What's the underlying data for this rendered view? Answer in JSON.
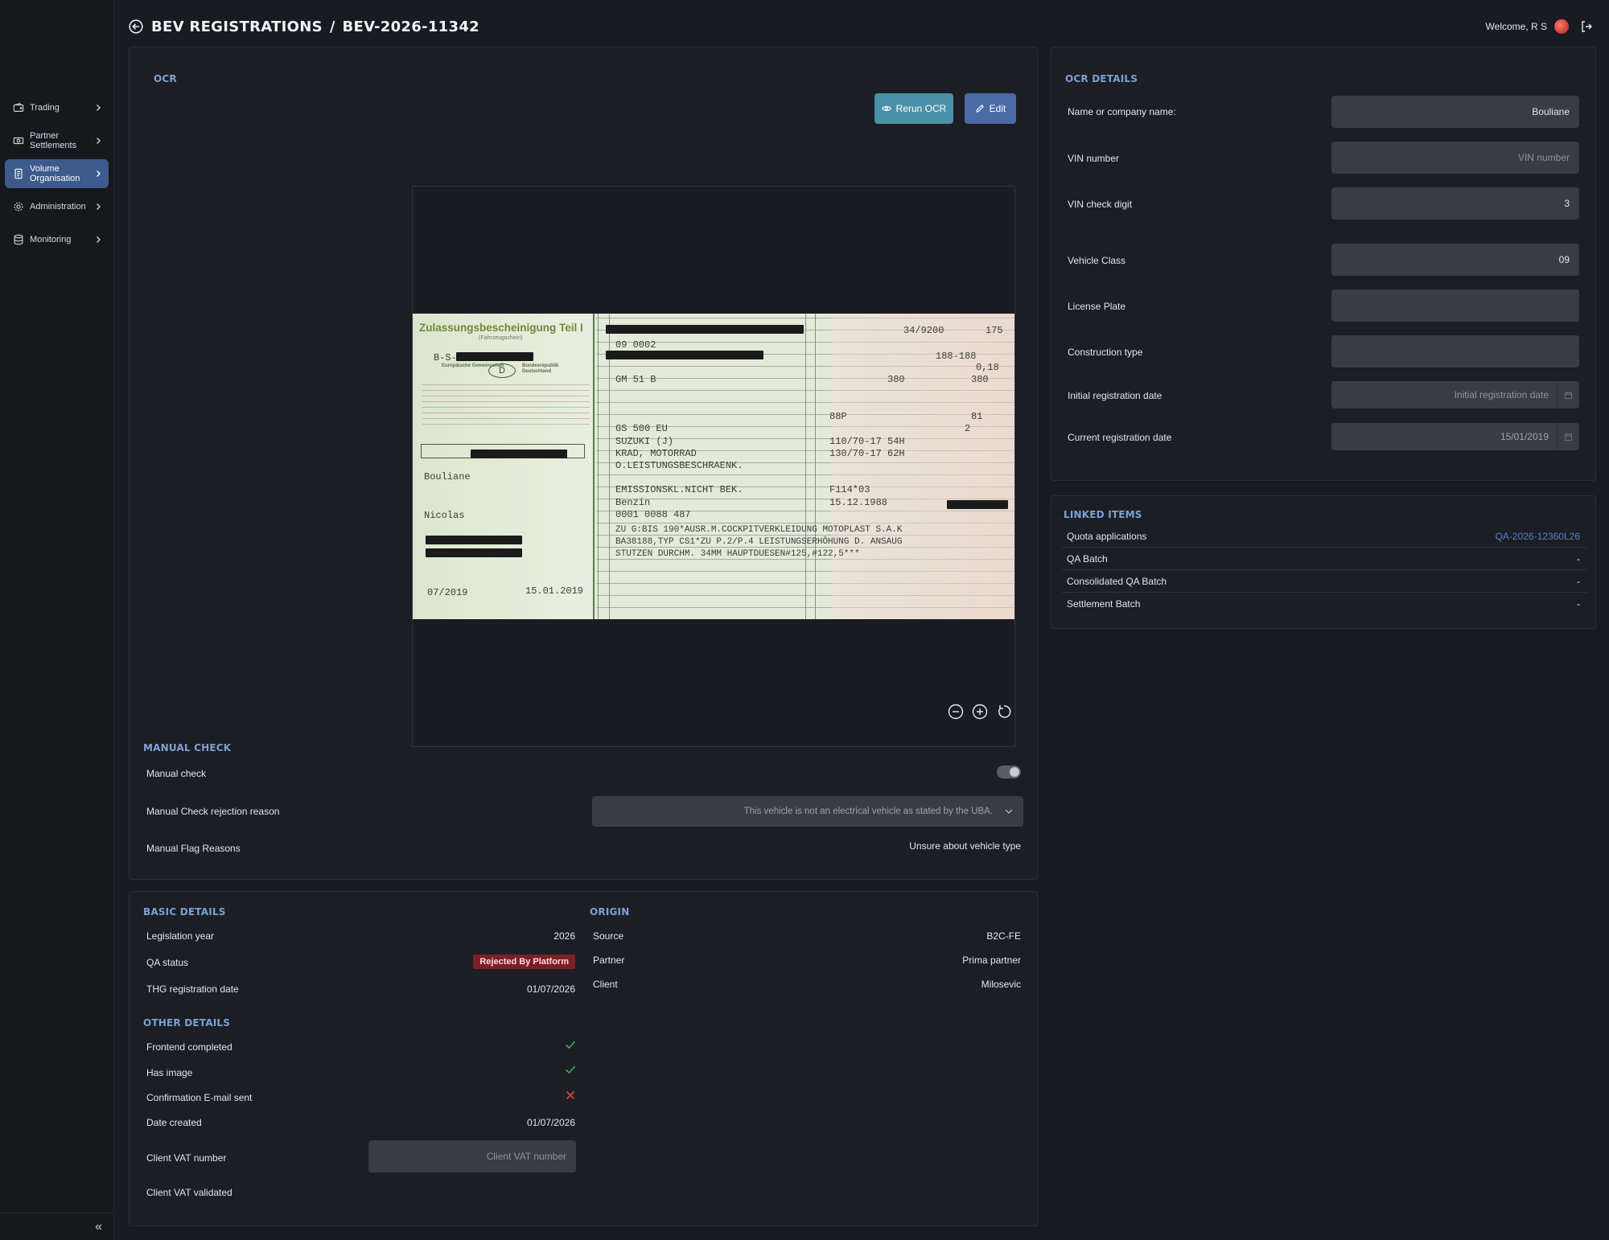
{
  "header": {
    "crumb_section": "BEV REGISTRATIONS",
    "crumb_sep": "/",
    "crumb_record": "BEV-2026-11342",
    "welcome": "Welcome, R S"
  },
  "sidebar": {
    "items": [
      {
        "label": "Trading",
        "icon": "wallet-icon"
      },
      {
        "label": "Partner Settlements",
        "icon": "money-icon"
      },
      {
        "label": "Volume Organisation",
        "icon": "document-icon",
        "active": true
      },
      {
        "label": "Administration",
        "icon": "gear-icon"
      },
      {
        "label": "Monitoring",
        "icon": "database-icon"
      }
    ],
    "collapse": "«"
  },
  "ocr": {
    "title": "OCR",
    "rerun_label": "Rerun OCR",
    "edit_label": "Edit",
    "doc": {
      "title": "Zulassungsbescheinigung Teil I",
      "subtitle": "(Fahrzeugschein)",
      "country": "D",
      "left_top": "Europäische Gemeinschaft",
      "left_right": "Bundesrepublik Deutschland",
      "prefix": "B-S-",
      "name": "Bouliane",
      "firstname": "Nicolas",
      "date_left": "07/2019",
      "date_right": "15.01.2019",
      "lines": [
        "09            0002",
        "GM 51 B",
        "GS 500 EU",
        "SUZUKI (J)",
        "KRAD, MOTORRAD",
        "O.LEISTUNGSBESCHRAENK.",
        "EMISSIONSKL.NICHT BEK.",
        "Benzin",
        "0001      0088      487",
        "ZU G:BIS 190*AUSR.M.COCKPITVERKLEIDUNG MOTOPLAST S.A.K",
        "BA38188,TYP CS1*ZU P.2/P.4 LEISTUNGSERHÖHUNG D. ANSAUG",
        "STUTZEN DURCHM. 34MM HAUPTDUESEN#125,#122,5***"
      ],
      "right_vals": [
        "34/9200",
        "175",
        "188-188",
        "0,18",
        "380",
        "380",
        "88P",
        "81",
        "2",
        "110/70-17 54H",
        "130/70-17 62H",
        "F114*03",
        "15.12.1988"
      ]
    }
  },
  "manual_check": {
    "title": "MANUAL CHECK",
    "manual_check_label": "Manual check",
    "rejection_label": "Manual Check rejection reason",
    "rejection_value": "This vehicle is not an electrical vehicle as stated by the UBA.",
    "flag_label": "Manual Flag Reasons",
    "flag_value": "Unsure about vehicle type"
  },
  "basic_details": {
    "title": "BASIC DETAILS",
    "rows": [
      {
        "label": "Legislation year",
        "value": "2026"
      },
      {
        "label": "QA status",
        "value": "Rejected By Platform"
      },
      {
        "label": "THG registration date",
        "value": "01/07/2026"
      }
    ]
  },
  "origin": {
    "title": "ORIGIN",
    "rows": [
      {
        "label": "Source",
        "value": "B2C-FE"
      },
      {
        "label": "Partner",
        "value": "Prima partner"
      },
      {
        "label": "Client",
        "value": "Milosevic"
      }
    ]
  },
  "other_details": {
    "title": "OTHER DETAILS",
    "frontend_label": "Frontend completed",
    "frontend_value": true,
    "image_label": "Has image",
    "image_value": true,
    "email_label": "Confirmation E-mail sent",
    "email_value": false,
    "created_label": "Date created",
    "created_value": "01/07/2026",
    "vat_label": "Client VAT number",
    "vat_placeholder": "Client VAT number",
    "vat_validated_label": "Client VAT validated"
  },
  "ocr_details": {
    "title": "OCR DETAILS",
    "name_label": "Name or company name:",
    "name_value": "Bouliane",
    "vin_label": "VIN number",
    "vin_placeholder": "VIN number",
    "vin_check_label": "VIN check digit",
    "vin_check_value": "3",
    "class_label": "Vehicle Class",
    "class_value": "09",
    "plate_label": "License Plate",
    "construction_label": "Construction type",
    "initial_label": "Initial registration date",
    "initial_placeholder": "Initial registration date",
    "current_label": "Current registration date",
    "current_value": "15/01/2019"
  },
  "linked_items": {
    "title": "LINKED ITEMS",
    "rows": [
      {
        "label": "Quota applications",
        "value": "QA-2026-12360L26",
        "link": true
      },
      {
        "label": "QA Batch",
        "value": "-"
      },
      {
        "label": "Consolidated QA Batch",
        "value": "-"
      },
      {
        "label": "Settlement Batch",
        "value": "-"
      }
    ]
  },
  "colors": {
    "accent": "#7aa1d6",
    "active_nav": "#3c5a8c",
    "rerun_button": "#4a90a8",
    "edit_button": "#4a6aa6",
    "rejected_badge": "#7d1f26",
    "check_ok": "#3fae5a",
    "check_fail": "#d9443f"
  }
}
